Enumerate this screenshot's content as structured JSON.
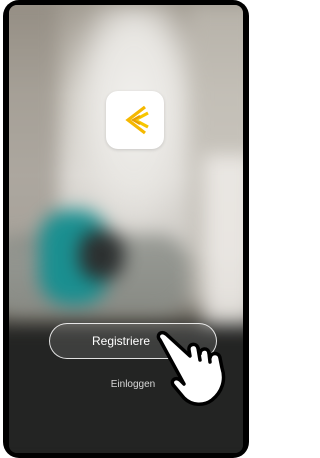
{
  "app": {
    "logo_icon": "yellow-chevron-logo-icon",
    "accent": "#f5b800"
  },
  "actions": {
    "register_label": "Registriere",
    "login_label": "Einloggen"
  },
  "overlay": {
    "pointer_icon": "pointing-hand-icon"
  }
}
